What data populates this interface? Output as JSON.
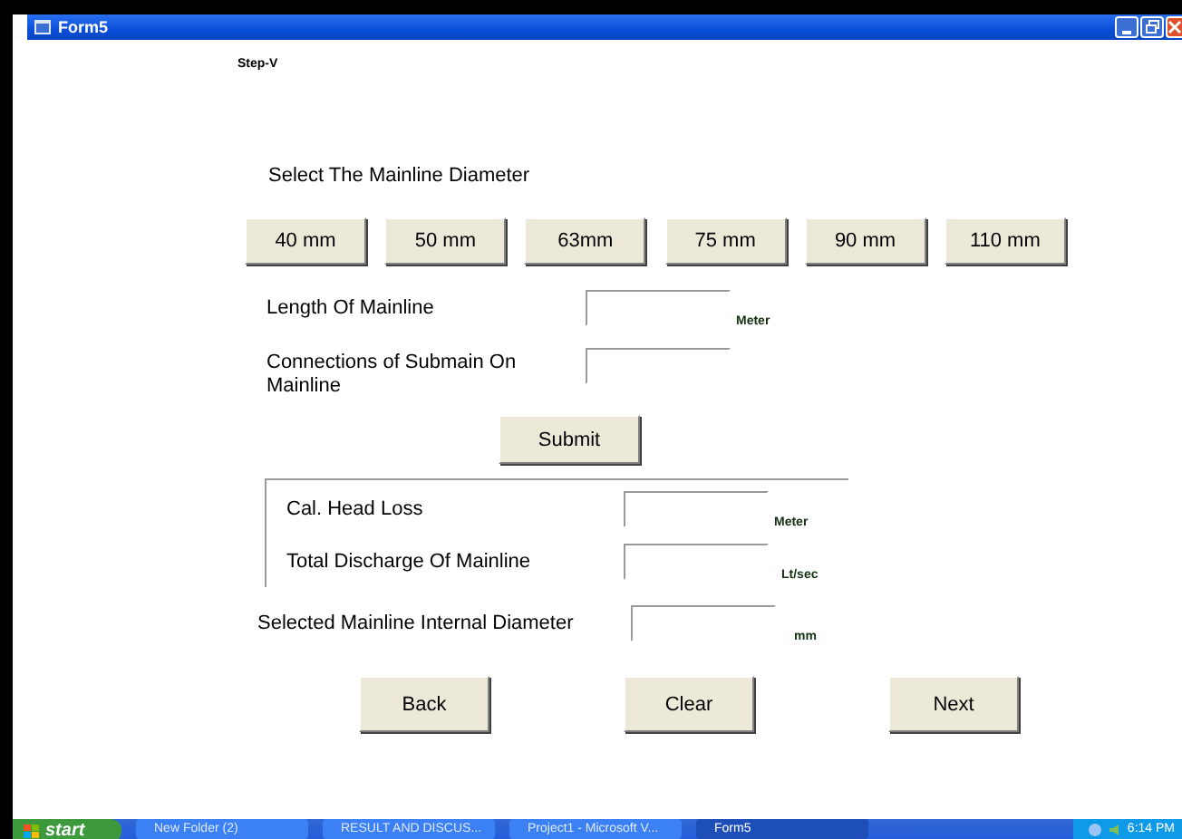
{
  "window": {
    "title": "Form5"
  },
  "step_label": "Step-V",
  "diameter_prompt": "Select The Mainline Diameter",
  "diameter_buttons": [
    "40 mm",
    "50 mm",
    "63mm",
    "75 mm",
    "90 mm",
    "110 mm"
  ],
  "input_fields": [
    {
      "label": "Length Of Mainline",
      "unit": "Meter"
    },
    {
      "label": "Connections of Submain On Mainline"
    }
  ],
  "submit_button": "Submit",
  "results": [
    {
      "label": "Cal. Head Loss",
      "unit": "Meter"
    },
    {
      "label": "Total Discharge Of Mainline",
      "unit": "Lt/sec"
    }
  ],
  "selected_diameter": {
    "label": "Selected Mainline Internal Diameter",
    "unit": "mm"
  },
  "nav_buttons": [
    "Back",
    "Clear",
    "Next"
  ],
  "taskbar": {
    "start": "start",
    "tasks": [
      {
        "label": "New Folder (2)",
        "selected": false
      },
      {
        "label": "RESULT AND DISCUS...",
        "selected": false
      },
      {
        "label": "Project1 - Microsoft V...",
        "selected": false
      },
      {
        "label": "Form5",
        "selected": true
      }
    ],
    "clock": "6:14 PM"
  }
}
